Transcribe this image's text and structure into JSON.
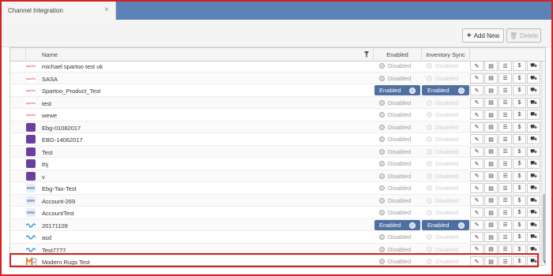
{
  "tab": {
    "label": "Channel Integration",
    "close": "×"
  },
  "toolbar": {
    "add_label": "Add New",
    "delete_label": "Delete"
  },
  "columns": {
    "name": "Name",
    "enabled": "Enabled",
    "sync": "Inventory Sync"
  },
  "rows": [
    {
      "name": "michael spartoo test uk",
      "logo": "spartoo",
      "enabled": "Disabled",
      "sync": "Disabled",
      "enabled_on": false,
      "sync_on": false
    },
    {
      "name": "SASA",
      "logo": "spartoo",
      "enabled": "Disabled",
      "sync": "Disabled",
      "enabled_on": false,
      "sync_on": false
    },
    {
      "name": "Spartoo_Product_Test",
      "logo": "spartoo",
      "enabled": "Enabled",
      "sync": "Enabled",
      "enabled_on": true,
      "sync_on": true
    },
    {
      "name": "test",
      "logo": "spartoo",
      "enabled": "Disabled",
      "sync": "Disabled",
      "enabled_on": false,
      "sync_on": false
    },
    {
      "name": "wewe",
      "logo": "spartoo",
      "enabled": "Disabled",
      "sync": "Disabled",
      "enabled_on": false,
      "sync_on": false
    },
    {
      "name": "Ebg-01082017",
      "logo": "purple",
      "enabled": "Disabled",
      "sync": "Disabled",
      "enabled_on": false,
      "sync_on": false
    },
    {
      "name": "EBG-14062017",
      "logo": "purple",
      "enabled": "Disabled",
      "sync": "Disabled",
      "enabled_on": false,
      "sync_on": false
    },
    {
      "name": "Test",
      "logo": "purple",
      "enabled": "Disabled",
      "sync": "Disabled",
      "enabled_on": false,
      "sync_on": false
    },
    {
      "name": "thj",
      "logo": "purple",
      "enabled": "Disabled",
      "sync": "Disabled",
      "enabled_on": false,
      "sync_on": false
    },
    {
      "name": "v",
      "logo": "purple",
      "enabled": "Disabled",
      "sync": "Disabled",
      "enabled_on": false,
      "sync_on": false
    },
    {
      "name": "Ebg-Tax-Test",
      "logo": "light",
      "enabled": "Disabled",
      "sync": "Disabled",
      "enabled_on": false,
      "sync_on": false
    },
    {
      "name": "Account-269",
      "logo": "light",
      "enabled": "Disabled",
      "sync": "Disabled",
      "enabled_on": false,
      "sync_on": false
    },
    {
      "name": "AccountTest",
      "logo": "light",
      "enabled": "Disabled",
      "sync": "Disabled",
      "enabled_on": false,
      "sync_on": false
    },
    {
      "name": "20171109",
      "logo": "wave",
      "enabled": "Enabled",
      "sync": "Enabled",
      "enabled_on": true,
      "sync_on": true
    },
    {
      "name": "asd",
      "logo": "wave",
      "enabled": "Disabled",
      "sync": "Disabled",
      "enabled_on": false,
      "sync_on": false
    },
    {
      "name": "Test7777",
      "logo": "wave",
      "enabled": "Disabled",
      "sync": "Disabled",
      "enabled_on": false,
      "sync_on": false
    },
    {
      "name": "Modern Rugs Test",
      "logo": "mr",
      "enabled": "Disabled",
      "sync": "Disabled",
      "enabled_on": false,
      "sync_on": false
    }
  ],
  "actions": [
    "edit-icon",
    "book-icon",
    "list-icon",
    "dollar-icon",
    "truck-icon"
  ],
  "action_glyphs": [
    "✎",
    "▤",
    "☰",
    "$",
    "⛟"
  ],
  "colors": {
    "accent": "#4f6fa0",
    "topbar": "#5c83b8",
    "highlight": "#d42020"
  }
}
